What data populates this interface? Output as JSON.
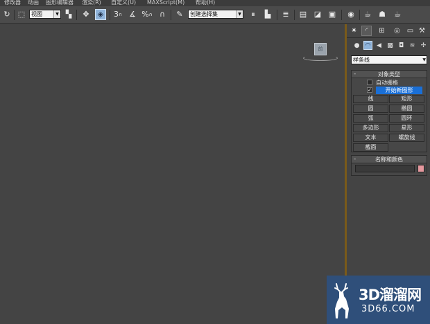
{
  "menu": [
    "修改器",
    "动画",
    "图形编辑器",
    "渲染(R)",
    "自定义(U)",
    "MAXScript(M)",
    "帮助(H)"
  ],
  "toolbar": {
    "view_select": "视图",
    "selection_set_select": "创建选择集",
    "snap_label": "3",
    "percent_snap_label": "%"
  },
  "viewport": {
    "viewcube_label": "前"
  },
  "panel": {
    "category_select": "样条线",
    "object_type": {
      "title": "对象类型",
      "auto_grid": "自动栅格",
      "start_new_shape": "开始新图形",
      "buttons": [
        "线",
        "矩形",
        "圆",
        "椭圆",
        "弧",
        "圆环",
        "多边形",
        "星形",
        "文本",
        "螺旋线",
        "截面"
      ]
    },
    "name_color": {
      "title": "名称和颜色",
      "name_value": "",
      "swatch_color": "#e5989e"
    }
  },
  "colors": {
    "accent_highlight": "#8fb3d9",
    "selection_blue": "#1a6fd6",
    "viewport_border": "#7a5a1a"
  },
  "watermark": {
    "line1": "3D溜溜网",
    "line2": "3D66.COM"
  }
}
